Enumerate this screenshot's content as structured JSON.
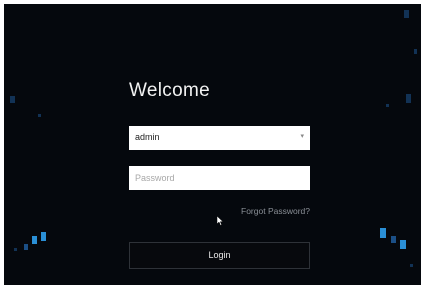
{
  "login": {
    "welcome": "Welcome",
    "username_value": "admin",
    "password_placeholder": "Password",
    "forgot_label": "Forgot Password?",
    "login_label": "Login"
  },
  "colors": {
    "background": "#05080d",
    "accent": "#2a8fd6"
  },
  "icons": {
    "dropdown": "chevron-down-icon",
    "cursor": "mouse-pointer-icon"
  }
}
